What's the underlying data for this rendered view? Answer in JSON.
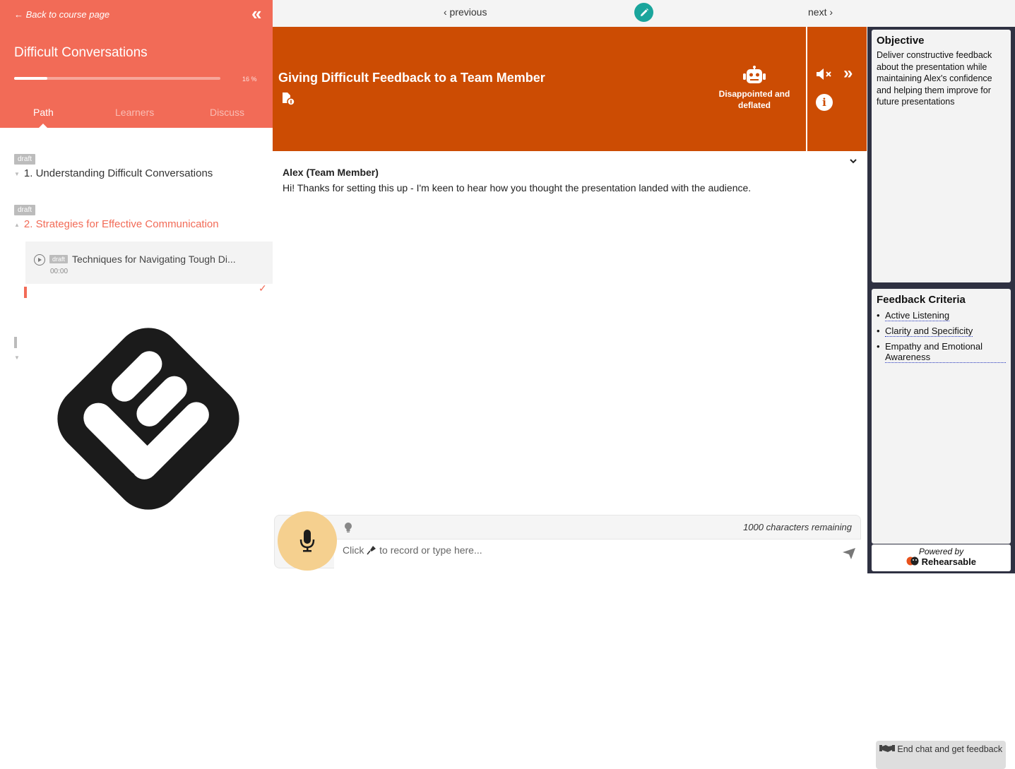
{
  "sidebar": {
    "back_link": "← Back to course page",
    "course_title": "Difficult Conversations",
    "progress_percent": 16,
    "progress_label": "16 %",
    "tabs": [
      {
        "label": "Path"
      },
      {
        "label": "Learners"
      },
      {
        "label": "Discuss"
      }
    ],
    "modules": [
      {
        "badge": "draft",
        "title": "1. Understanding Difficult Conversations"
      },
      {
        "badge": "draft",
        "title": "2. Strategies for Effective Communication"
      }
    ],
    "lesson": {
      "badge": "draft",
      "title": "Techniques for Navigating Tough Di...",
      "time": "00:00"
    }
  },
  "topnav": {
    "previous": "‹ previous",
    "next": "next ›"
  },
  "scenario": {
    "title": "Giving Difficult Feedback to a Team Member",
    "mood": "Disappointed and deflated"
  },
  "chat": {
    "messages": [
      {
        "sender": "Alex (Team Member)",
        "text": "Hi! Thanks for setting this up - I'm keen to hear how you thought the presentation landed with the audience."
      }
    ]
  },
  "composer": {
    "chars_remaining": "1000 characters remaining",
    "placeholder_before": "Click",
    "placeholder_after": "to record or type here..."
  },
  "right_panel": {
    "objective_heading": "Objective",
    "objective_text": "Deliver constructive feedback about the presentation while maintaining Alex's confidence and helping them improve for future presentations",
    "criteria_heading": "Feedback Criteria",
    "criteria": [
      "Active Listening",
      "Clarity and Specificity",
      "Empathy and Emotional Awareness"
    ],
    "end_chat": "End chat and get feedback",
    "powered_by": "Powered by",
    "brand": "Rehearsable"
  },
  "colors": {
    "sidebar_accent": "#f26b57",
    "scenario_bg": "#cc4c03",
    "edit_button": "#1aa59c",
    "mic_button": "#f5d08f",
    "right_panel_bg": "#2f3142"
  }
}
